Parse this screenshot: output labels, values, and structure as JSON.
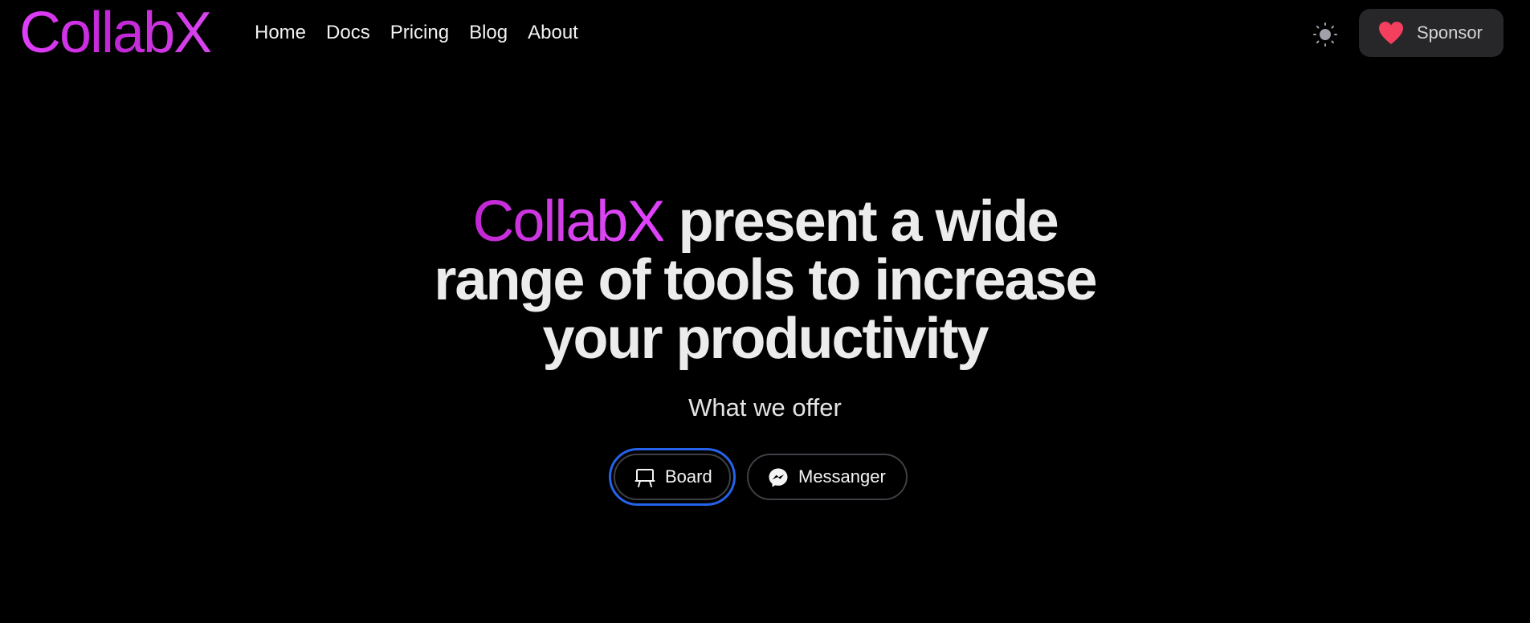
{
  "app": {
    "brand": "CollabX"
  },
  "nav": {
    "items": [
      {
        "label": "Home"
      },
      {
        "label": "Docs"
      },
      {
        "label": "Pricing"
      },
      {
        "label": "Blog"
      },
      {
        "label": "About"
      }
    ]
  },
  "header": {
    "theme_toggle_icon": "sun-icon",
    "sponsor": {
      "label": "Sponsor",
      "icon": "heart-icon"
    }
  },
  "hero": {
    "title_brand": "CollabX",
    "title_rest_line1": " present a wide",
    "title_line2": "range of tools to increase",
    "title_line3": "your productivity",
    "subtitle": "What we offer"
  },
  "offers": {
    "board": {
      "label": "Board",
      "icon": "board-icon"
    },
    "messenger": {
      "label": "Messanger",
      "icon": "messenger-icon"
    }
  },
  "colors": {
    "background": "#000000",
    "brand_gradient_start": "#c026d3",
    "brand_gradient_end": "#e040fb",
    "sponsor_bg": "#27272a",
    "heart": "#f43f5e",
    "focus_ring": "#2563eb"
  }
}
